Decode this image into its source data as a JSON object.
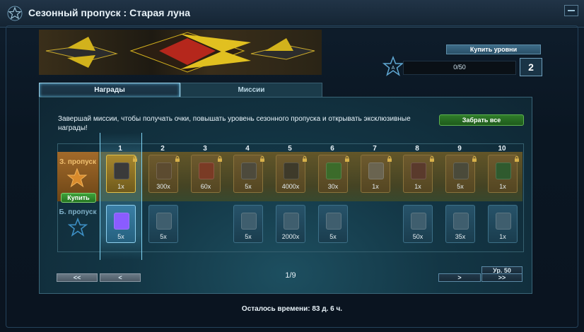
{
  "window": {
    "title": "Сезонный пропуск : Старая луна"
  },
  "level": {
    "buy_label": "Купить уровни",
    "progress_text": "0/50",
    "progress_fraction": 0.0,
    "current": "2"
  },
  "tabs": [
    {
      "label": "Награды",
      "active": true
    },
    {
      "label": "Миссии",
      "active": false
    }
  ],
  "description": "Завершай миссии, чтобы получать очки, повышать уровень сезонного пропуска и открывать эксклюзивные награды!",
  "claim_all_label": "Забрать все",
  "rows": {
    "premium": {
      "label": "З. пропуск",
      "buy_label": "Купить"
    },
    "basic": {
      "label": "Б. пропуск"
    }
  },
  "columns": [
    "1",
    "2",
    "3",
    "4",
    "5",
    "6",
    "7",
    "8",
    "9",
    "10"
  ],
  "premium_rewards": [
    "1x",
    "300x",
    "60x",
    "5x",
    "4000x",
    "30x",
    "1x",
    "1x",
    "5x",
    "1x"
  ],
  "basic_rewards": [
    "5x",
    "5x",
    "",
    "5x",
    "2000x",
    "5x",
    "",
    "50x",
    "35x",
    "1x"
  ],
  "nav": {
    "first": "<<",
    "prev": "<",
    "page": "1/9",
    "next": ">",
    "last": ">>",
    "level_jump": "Ур. 50"
  },
  "timer": "Осталось времени: 83 д. 6 ч."
}
